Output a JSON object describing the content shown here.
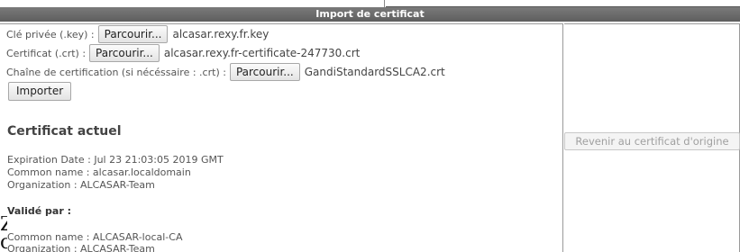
{
  "header": {
    "title": "Import de certificat"
  },
  "form": {
    "private_key": {
      "label": "Clé privée (.key) :",
      "button": "Parcourir...",
      "file": "alcasar.rexy.fr.key"
    },
    "certificate": {
      "label": "Certificat (.crt) :",
      "button": "Parcourir...",
      "file": "alcasar.rexy.fr-certificate-247730.crt"
    },
    "chain": {
      "label": "Chaîne de certification (si nécéssaire : .crt) :",
      "button": "Parcourir...",
      "file": "GandiStandardSSLCA2.crt"
    },
    "import_button": "Importer"
  },
  "current_cert": {
    "title": "Certificat actuel",
    "expiration": "Expiration Date : Jul 23 21:03:05 2019 GMT",
    "common_name": "Common name : alcasar.localdomain",
    "organization": "Organization : ALCASAR-Team",
    "validated_by_title": "Validé par :",
    "issuer_common_name": "Common name : ALCASAR-local-CA",
    "issuer_organization": "Organization : ALCASAR-Team"
  },
  "right": {
    "revert_button": "Revenir au certificat d'origine"
  },
  "edge_glyphs": "Z\nc"
}
